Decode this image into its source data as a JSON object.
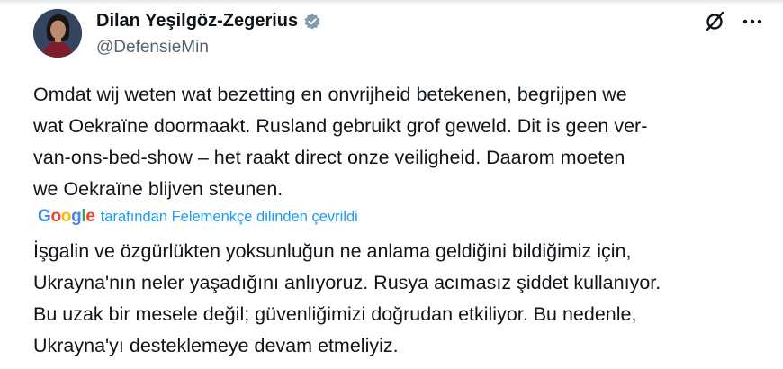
{
  "author": {
    "name": "Dilan Yeşilgöz-Zegerius",
    "handle": "@DefensieMin"
  },
  "icons": {
    "verified": "verified-badge-icon",
    "grok": "grok-icon",
    "more": "more-options-icon"
  },
  "tweet": {
    "original_lines": [
      "Omdat wij weten wat bezetting en onvrijheid betekenen, begrijpen we",
      "wat Oekraïne doormaakt. Rusland gebruikt grof geweld. Dit is geen ver-",
      "van-ons-bed-show – het raakt direct onze veiligheid. Daarom moeten",
      "we Oekraïne blijven steunen."
    ],
    "translation_source": {
      "logo_letters": [
        "G",
        "o",
        "o",
        "g",
        "l",
        "e"
      ],
      "label": "tarafından Felemenkçe dilinden çevrildi"
    },
    "translated_lines": [
      "İşgalin ve özgürlükten yoksunluğun ne anlama geldiğini bildiğimiz için,",
      "Ukrayna'nın neler yaşadığını anlıyoruz. Rusya acımasız şiddet kullanıyor.",
      "Bu uzak bir mesele değil; güvenliğimizi doğrudan etkiliyor. Bu nedenle,",
      "Ukrayna'yı desteklemeye devam etmeliyiz."
    ]
  },
  "colors": {
    "text": "#0f1419",
    "secondary": "#536471",
    "link": "#1d9bf0",
    "verified": "#829aab",
    "google_blue": "#4285F4",
    "google_red": "#EA4335",
    "google_yellow": "#FBBC05",
    "google_green": "#34A853"
  }
}
